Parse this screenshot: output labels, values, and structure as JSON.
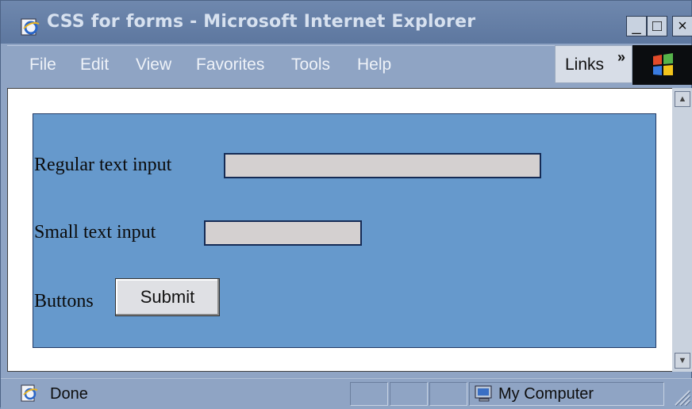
{
  "window": {
    "title": "CSS for forms - Microsoft Internet Explorer",
    "controls": {
      "minimize": "_",
      "maximize": "□",
      "close": "×"
    }
  },
  "menu": {
    "items": [
      "File",
      "Edit",
      "View",
      "Favorites",
      "Tools",
      "Help"
    ],
    "links_label": "Links",
    "links_chevron": "»"
  },
  "form": {
    "regular_label": "Regular text input",
    "regular_value": "",
    "small_label": "Small text input",
    "small_value": "",
    "buttons_label": "Buttons",
    "submit_label": "Submit"
  },
  "status": {
    "text": "Done",
    "zone": "My Computer"
  },
  "colors": {
    "form_background": "#6699cc",
    "form_border": "#213a66",
    "input_background": "#d4d0d0",
    "window_chrome": "#8fa4c4"
  },
  "icons": [
    "ie-page-icon",
    "windows-logo-icon",
    "my-computer-icon",
    "done-page-icon"
  ]
}
